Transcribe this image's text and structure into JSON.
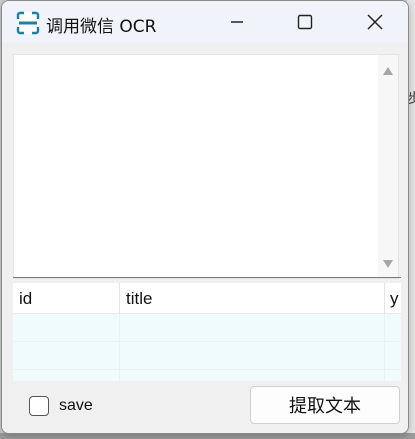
{
  "window": {
    "title": "调用微信 OCR",
    "icon": "scan-icon",
    "controls": [
      "minimize-icon",
      "maximize-icon",
      "close-icon"
    ]
  },
  "output": {
    "text": ""
  },
  "table": {
    "columns": [
      "id",
      "title",
      "y"
    ],
    "rows": [
      [
        "",
        "",
        ""
      ],
      [
        "",
        "",
        ""
      ],
      [
        "",
        "",
        ""
      ]
    ]
  },
  "footer": {
    "save_label": "save",
    "save_checked": false,
    "extract_label": "提取文本"
  },
  "background": {
    "glyph": "步"
  },
  "colors": {
    "row_bg": "#f0fbfd",
    "title_bar": "#f0f3f9",
    "icon_accent": "#1e7fa5"
  }
}
